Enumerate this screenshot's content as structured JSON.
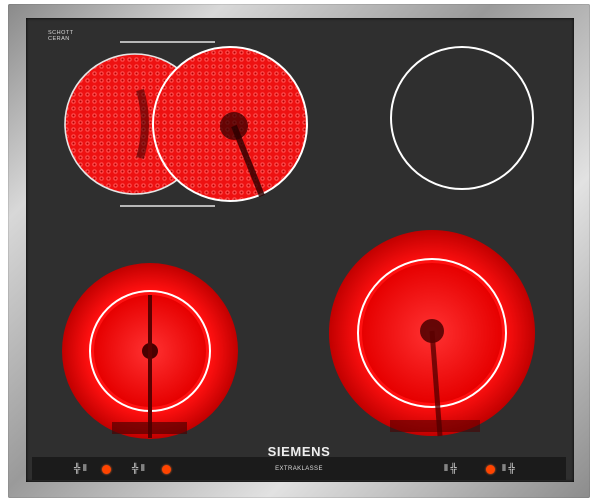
{
  "brand": {
    "top_lines": [
      "SCHOTT",
      "CERAN"
    ],
    "small_line": "CERAN"
  },
  "logo": "SIEMENS",
  "panel": {
    "label": "EXTRAKLASSE"
  },
  "colors": {
    "glass": "#2f2f2f",
    "heating": "#ff1e1e",
    "indicator": "#ff4400",
    "ring": "#ffffff"
  },
  "zones": [
    {
      "name": "rear-left",
      "type": "oval-dual",
      "state": "on"
    },
    {
      "name": "rear-right",
      "type": "single",
      "state": "off"
    },
    {
      "name": "front-left",
      "type": "dual-circuit",
      "state": "on"
    },
    {
      "name": "front-right",
      "type": "dual-circuit",
      "state": "on"
    }
  ],
  "controls": [
    {
      "name": "front-left",
      "icon": "zone-front-left-icon"
    },
    {
      "name": "rear-left",
      "icon": "zone-rear-left-icon"
    },
    {
      "name": "rear-right",
      "icon": "zone-rear-right-icon"
    },
    {
      "name": "front-right",
      "icon": "zone-front-right-icon"
    }
  ]
}
